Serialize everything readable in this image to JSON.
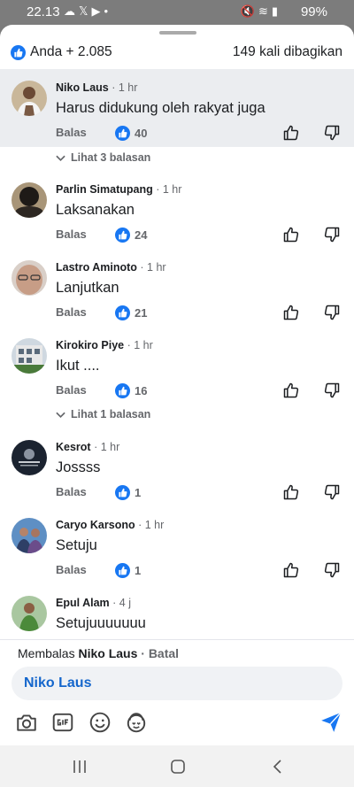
{
  "status_bar": {
    "time": "22.13",
    "left_icons": [
      "cloud-icon",
      "x-icon",
      "youtube-icon",
      "dot-icon"
    ],
    "right_icons": [
      "mute-icon",
      "wifi-icon",
      "signal-icon"
    ],
    "battery": "99%"
  },
  "header": {
    "reactions": "Anda + 2.085",
    "shares": "149 kali dibagikan"
  },
  "labels": {
    "reply": "Balas",
    "view_replies_3": "Lihat 3 balasan",
    "view_replies_1": "Lihat 1 balasan"
  },
  "comments": [
    {
      "name": "Niko Laus",
      "meta": " · 1 hr",
      "text": "Harus didukung oleh rakyat juga",
      "likes": "40"
    },
    {
      "name": "Parlin Simatupang",
      "meta": " · 1 hr",
      "text": "Laksanakan",
      "likes": "24"
    },
    {
      "name": "Lastro Aminoto",
      "meta": " · 1 hr",
      "text": "Lanjutkan",
      "likes": "21"
    },
    {
      "name": "Kirokiro Piye",
      "meta": " · 1 hr",
      "text": "Ikut ....",
      "likes": "16"
    },
    {
      "name": "Kesrot",
      "meta": " · 1 hr",
      "text": "Jossss",
      "likes": "1"
    },
    {
      "name": "Caryo Karsono",
      "meta": " · 1 hr",
      "text": "Setuju",
      "likes": "1"
    },
    {
      "name": "Epul Alam",
      "meta": " · 4 j",
      "text": "Setujuuuuuuu"
    }
  ],
  "reply_bar": {
    "prefix": "Membalas ",
    "target": "Niko Laus",
    "cancel": " · Batal",
    "mention": "Niko Laus"
  },
  "colors": {
    "accent": "#1877f2",
    "mention": "#1466cc",
    "highlight": "#ebedf0"
  }
}
